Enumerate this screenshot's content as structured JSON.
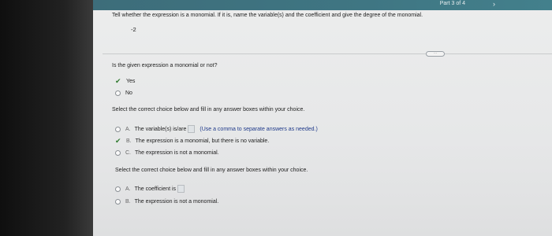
{
  "header": {
    "part_label": "Part 3 of 4",
    "next_icon": "chevron-right-icon"
  },
  "question": {
    "instruction": "Tell whether the expression is a monomial. If it is, name the variable(s) and the coefficient and give the degree of the monomial.",
    "expression": "-2"
  },
  "more_pill": "",
  "q1": {
    "prompt": "Is the given expression a monomial or not?",
    "options": [
      {
        "label": "Yes",
        "selected": true
      },
      {
        "label": "No",
        "selected": false
      }
    ]
  },
  "q2": {
    "prompt": "Select the correct choice below and fill in any answer boxes within your choice.",
    "options": [
      {
        "letter": "A.",
        "label": "The variable(s) is/are",
        "hint": "(Use a comma to separate answers as needed.)"
      },
      {
        "letter": "B.",
        "label": "The expression is a monomial, but there is no variable.",
        "selected": true
      },
      {
        "letter": "C.",
        "label": "The expression is not a monomial."
      }
    ]
  },
  "q3": {
    "prompt": "Select the correct choice below and fill in any answer boxes within your choice.",
    "options": [
      {
        "letter": "A.",
        "label": "The coefficient is"
      },
      {
        "letter": "B.",
        "label": "The expression is not a monomial."
      }
    ]
  },
  "colors": {
    "topbar": "#3f7683",
    "check": "#2f7a2f",
    "hint": "#1f3a8a"
  }
}
